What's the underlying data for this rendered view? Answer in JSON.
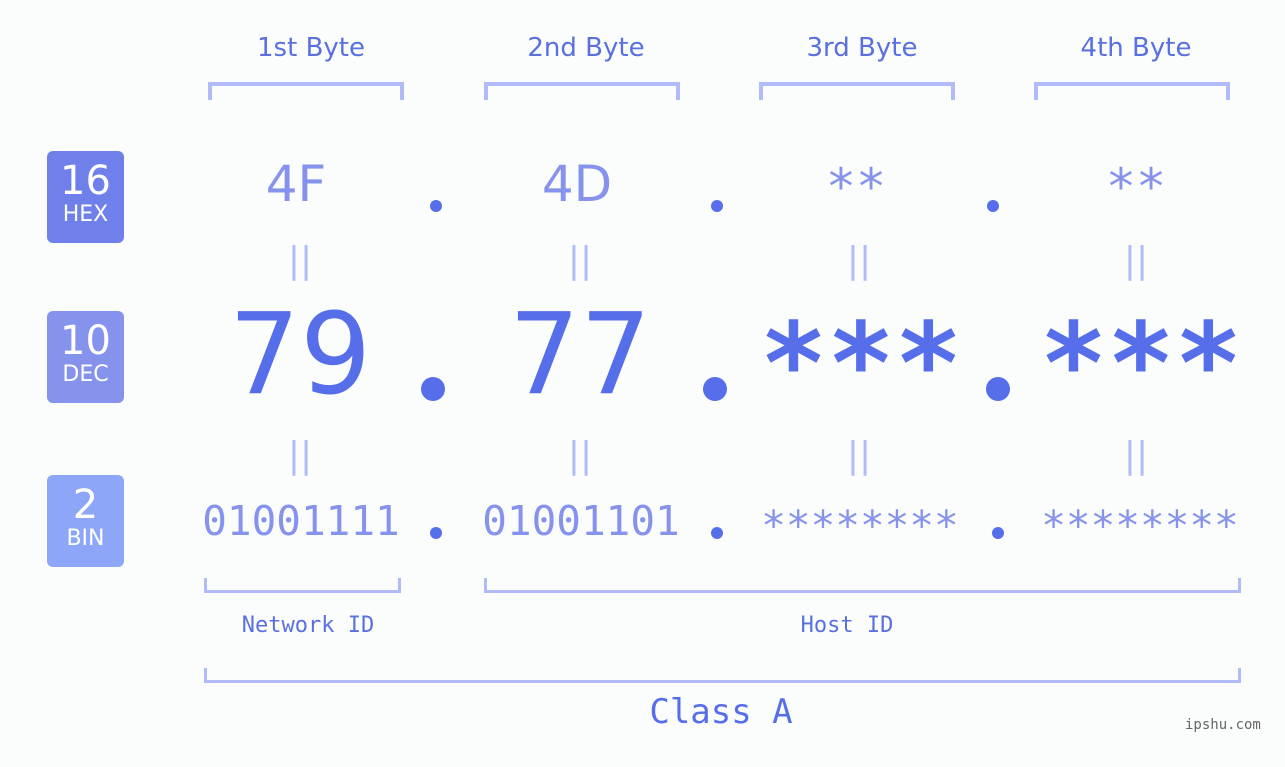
{
  "byte_headers": [
    "1st Byte",
    "2nd Byte",
    "3rd Byte",
    "4th Byte"
  ],
  "bases": [
    {
      "number": "16",
      "label": "HEX",
      "color": "#6f80ea"
    },
    {
      "number": "10",
      "label": "DEC",
      "color": "#8593ec"
    },
    {
      "number": "2",
      "label": "BIN",
      "color": "#8da6f8"
    }
  ],
  "hex": [
    "4F",
    "4D",
    "**",
    "**"
  ],
  "dec": [
    "79",
    "77",
    "***",
    "***"
  ],
  "bin": [
    "01001111",
    "01001101",
    "********",
    "********"
  ],
  "separator": ".",
  "equals": "||",
  "network_id_label": "Network ID",
  "host_id_label": "Host ID",
  "class_label": "Class A",
  "site": "ipshu.com",
  "colors": {
    "accent": "#566ee9",
    "light": "#8593ec",
    "bracket": "#b0bbf8"
  }
}
